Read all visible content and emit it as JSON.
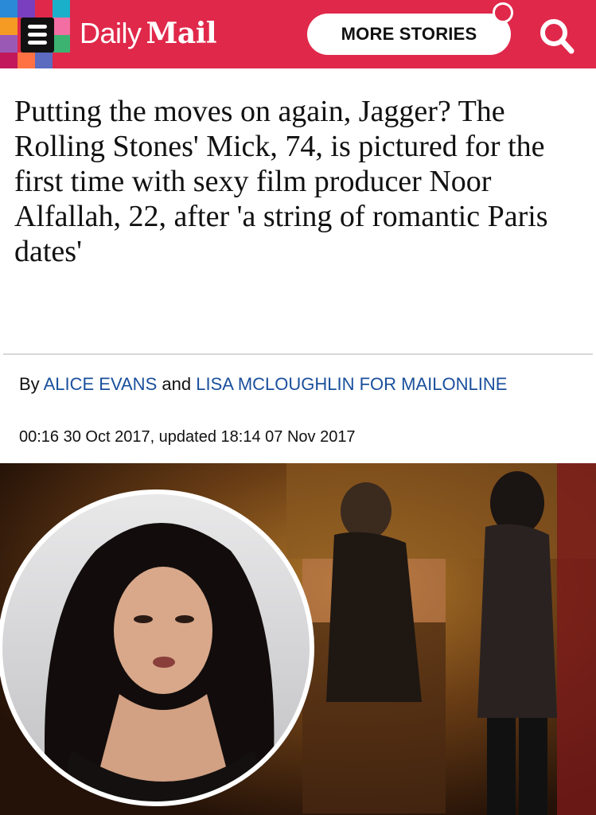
{
  "header": {
    "logo_daily": "Daily",
    "logo_mail": "Mail",
    "more_stories_label": "MORE STORIES",
    "icons": [
      "menu-icon",
      "notification-dot",
      "search-icon"
    ],
    "colors": {
      "brand": "#e0284a",
      "link": "#1a4f9c"
    }
  },
  "article": {
    "headline": "Putting the moves on again, Jagger? The Rolling Stones' Mick, 74, is pictured for the first time with sexy film producer Noor Alfallah, 22, after 'a string of romantic Paris dates'",
    "byline": {
      "prefix": "By",
      "author1": "ALICE EVANS",
      "conjunction": "and",
      "author2": "LISA MCLOUGHLIN FOR MAILONLINE"
    },
    "timestamp": "00:16 30 Oct 2017, updated 18:14 07 Nov 2017"
  }
}
